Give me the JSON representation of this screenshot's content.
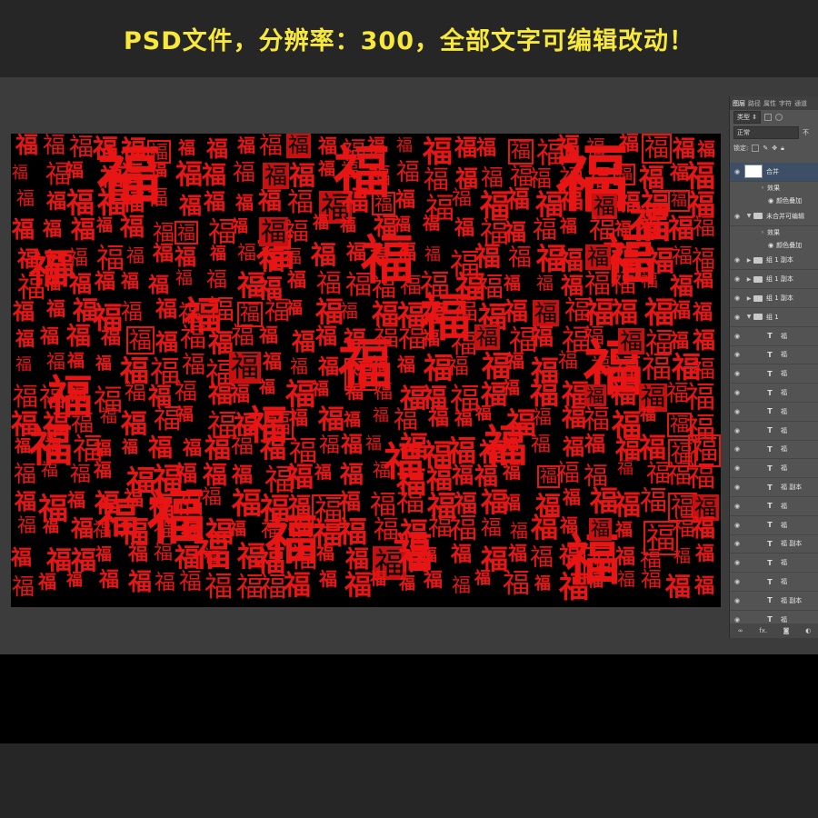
{
  "banner": {
    "text": "PSD文件，分辨率：300，全部文字可编辑改动！"
  },
  "colors": {
    "banner_text": "#f7e83a",
    "fu_red": "#e81515"
  },
  "canvas": {
    "glyph": "福"
  },
  "layers_panel": {
    "tabs": [
      "图层",
      "路径",
      "属性",
      "字符",
      "通道"
    ],
    "filter_label": "类型",
    "blend_mode": "正常",
    "opacity_label": "不",
    "lock_label": "锁定:",
    "layers": [
      {
        "name": "合并",
        "type": "pixel",
        "selected": true
      },
      {
        "name": "效果",
        "type": "effects"
      },
      {
        "name": "颜色叠加",
        "type": "effect"
      },
      {
        "name": "未合并可编辑",
        "type": "group",
        "open": true
      },
      {
        "name": "效果",
        "type": "effects"
      },
      {
        "name": "颜色叠加",
        "type": "effect"
      },
      {
        "name": "组 1 副本",
        "type": "group"
      },
      {
        "name": "组 1 副本",
        "type": "group"
      },
      {
        "name": "组 1 副本",
        "type": "group"
      },
      {
        "name": "组 1",
        "type": "group",
        "open": true
      },
      {
        "name": "福",
        "type": "text"
      },
      {
        "name": "福",
        "type": "text"
      },
      {
        "name": "福",
        "type": "text"
      },
      {
        "name": "福",
        "type": "text"
      },
      {
        "name": "福",
        "type": "text"
      },
      {
        "name": "福",
        "type": "text"
      },
      {
        "name": "福",
        "type": "text"
      },
      {
        "name": "福",
        "type": "text"
      },
      {
        "name": "福 副本",
        "type": "text"
      },
      {
        "name": "福",
        "type": "text"
      },
      {
        "name": "福",
        "type": "text"
      },
      {
        "name": "福 副本",
        "type": "text"
      },
      {
        "name": "福",
        "type": "text"
      },
      {
        "name": "福",
        "type": "text"
      },
      {
        "name": "福 副本",
        "type": "text"
      },
      {
        "name": "福",
        "type": "text"
      }
    ],
    "footer_icons": [
      "link-icon",
      "fx-icon",
      "mask-icon",
      "adjustment-icon"
    ],
    "footer_fx_label": "fx."
  }
}
